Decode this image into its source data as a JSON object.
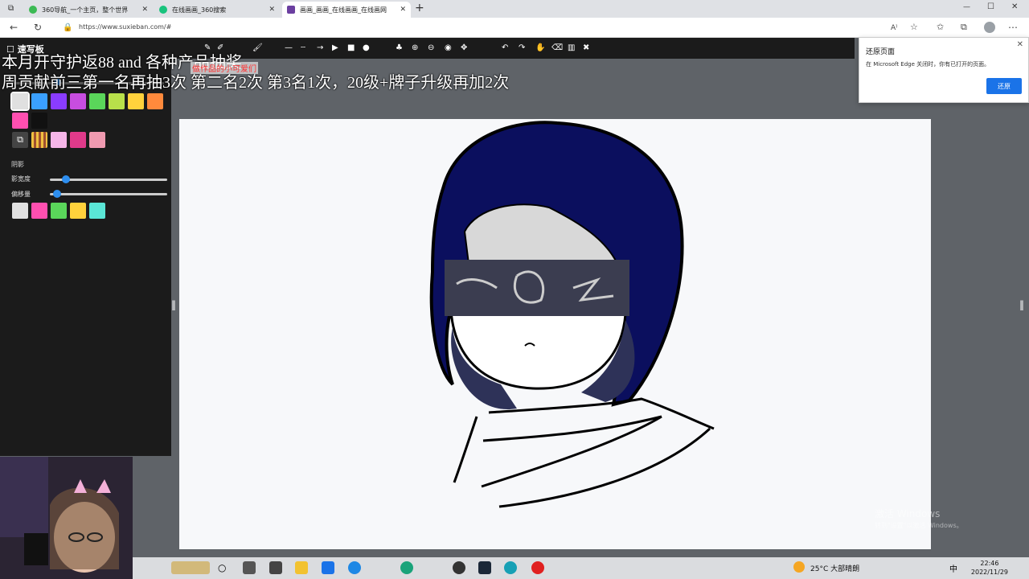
{
  "browser": {
    "tabs": [
      {
        "title": "360导航_一个主页，整个世界",
        "color": "#3cba54"
      },
      {
        "title": "在线画画_360搜索",
        "color": "#19c37d"
      },
      {
        "title": "画画_画画_在线画画_在线画网",
        "color": "#6b3fa0"
      }
    ],
    "new_tab": "+",
    "url": "https://www.suxieban.com/#",
    "window_controls": [
      "—",
      "☐",
      "✕"
    ]
  },
  "app": {
    "logo": "速写板",
    "shadow_label": "阴影",
    "shadow_width_label": "影宽度",
    "offset_label": "偏移量",
    "shadow_width_value": 0.1,
    "offset_value": 0.03,
    "palette": [
      "#e0e0e0",
      "#3aa0ff",
      "#8a3cff",
      "#c84de0",
      "#5ad65a",
      "#b8e04a",
      "#ffd23c",
      "#ff8a3c",
      "#ff4fb0",
      "#111111"
    ],
    "shadow_palette": [
      "#e0e0e0",
      "#ff4fb0",
      "#5ad65a",
      "#ffd23c",
      "#5ae6d6"
    ]
  },
  "overlay": {
    "line1": "本月开守护返88 and 各种产品抽奖",
    "line2": "周贡献前三第一名再抽3次 第二名2次 第3名1次，20级+牌子升级再加2次",
    "red_tag": "做作品的小可爱们"
  },
  "popup": {
    "title": "还原页面",
    "message": "在 Microsoft Edge 关闭时，你有已打开的页面。",
    "button": "还原",
    "close": "✕"
  },
  "watermark": {
    "line1": "激活 Windows",
    "line2": "转到\"设置\"以激活 Windows。"
  },
  "taskbar": {
    "weather": "25°C  大部晴朗",
    "time": "22:46",
    "date": "2022/11/29",
    "ime": "中"
  }
}
